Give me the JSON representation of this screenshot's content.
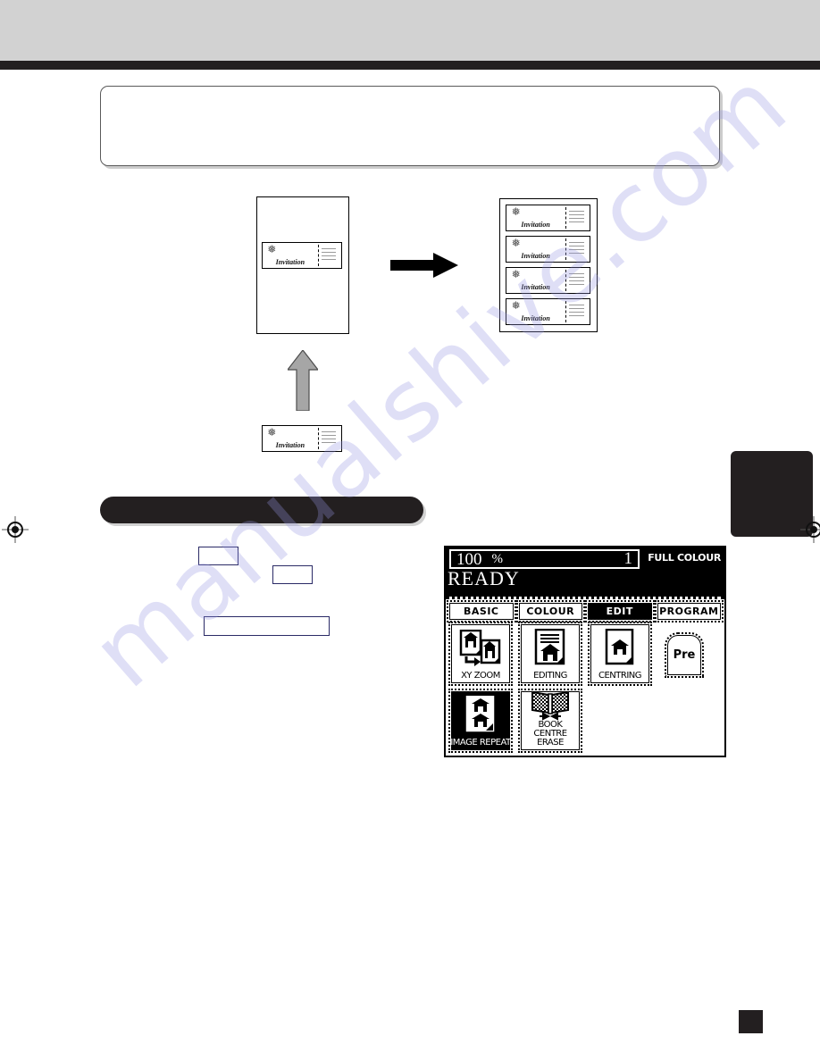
{
  "page": {
    "bottom_page_marker": "",
    "watermark_text": "manualshive.com"
  },
  "illustration": {
    "original_card_label": "Invitation",
    "output_card_labels": [
      "Invitation",
      "Invitation",
      "Invitation",
      "Invitation"
    ],
    "source_card_label": "Invitation",
    "arrow_right_name": "right-arrow",
    "arrow_up_name": "up-arrow"
  },
  "lcd": {
    "status": {
      "zoom_value": "100",
      "zoom_unit": "%",
      "copy_count": "1",
      "colour_mode": "FULL COLOUR",
      "ready_text": "READY"
    },
    "tabs": [
      {
        "label": "BASIC",
        "active": false
      },
      {
        "label": "COLOUR",
        "active": false
      },
      {
        "label": "EDIT",
        "active": true
      },
      {
        "label": "PROGRAM",
        "active": false
      }
    ],
    "functions": [
      {
        "label": "XY ZOOM",
        "icon": "two-documents-zoom-icon",
        "selected": false,
        "two_line": false
      },
      {
        "label": "EDITING",
        "icon": "document-lines-house-icon",
        "selected": false,
        "two_line": false
      },
      {
        "label": "CENTRING",
        "icon": "document-centred-house-icon",
        "selected": false,
        "two_line": false
      },
      {
        "label": "IMAGE REPEAT",
        "icon": "document-repeated-house-icon",
        "selected": true,
        "two_line": false
      },
      {
        "label": "BOOK CENTRE ERASE",
        "icon": "open-book-arrows-icon",
        "selected": false,
        "two_line": true
      }
    ],
    "preset_tab": {
      "label": "Pre"
    }
  },
  "colors": {
    "header_band": "#d2d2d2",
    "rule": "#231f20",
    "section_bar": "#231f20",
    "thumb_tab": "#231f20",
    "lcd_background": "#000000",
    "lcd_foreground": "#ffffff",
    "watermark": "#9696e1"
  }
}
